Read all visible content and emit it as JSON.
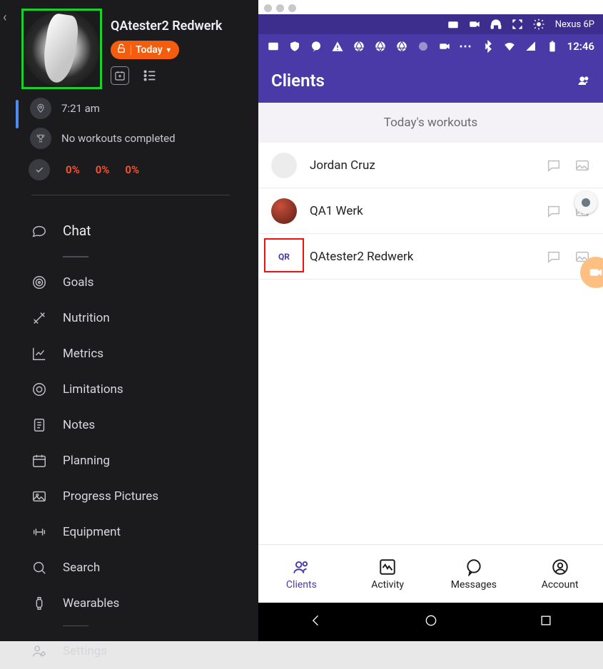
{
  "left": {
    "profile_name": "QAtester2 Redwerk",
    "today_label": "Today",
    "time": "7:21 am",
    "workouts_text": "No workouts completed",
    "percents": [
      "0%",
      "0%",
      "0%"
    ],
    "nav": {
      "chat": "Chat",
      "items": [
        {
          "label": "Goals"
        },
        {
          "label": "Nutrition"
        },
        {
          "label": "Metrics"
        },
        {
          "label": "Limitations"
        },
        {
          "label": "Notes"
        },
        {
          "label": "Planning"
        },
        {
          "label": "Progress Pictures"
        },
        {
          "label": "Equipment"
        },
        {
          "label": "Search"
        },
        {
          "label": "Wearables"
        }
      ],
      "settings": "Settings"
    }
  },
  "phone": {
    "device": "Nexus 6P",
    "clock": "12:46",
    "appbar_title": "Clients",
    "subheader": "Today's workouts",
    "clients": [
      {
        "name": "Jordan Cruz"
      },
      {
        "name": "QA1 Werk"
      },
      {
        "name": "QAtester2 Redwerk",
        "initials": "QR"
      }
    ],
    "tabs": [
      {
        "label": "Clients"
      },
      {
        "label": "Activity"
      },
      {
        "label": "Messages"
      },
      {
        "label": "Account"
      }
    ]
  }
}
